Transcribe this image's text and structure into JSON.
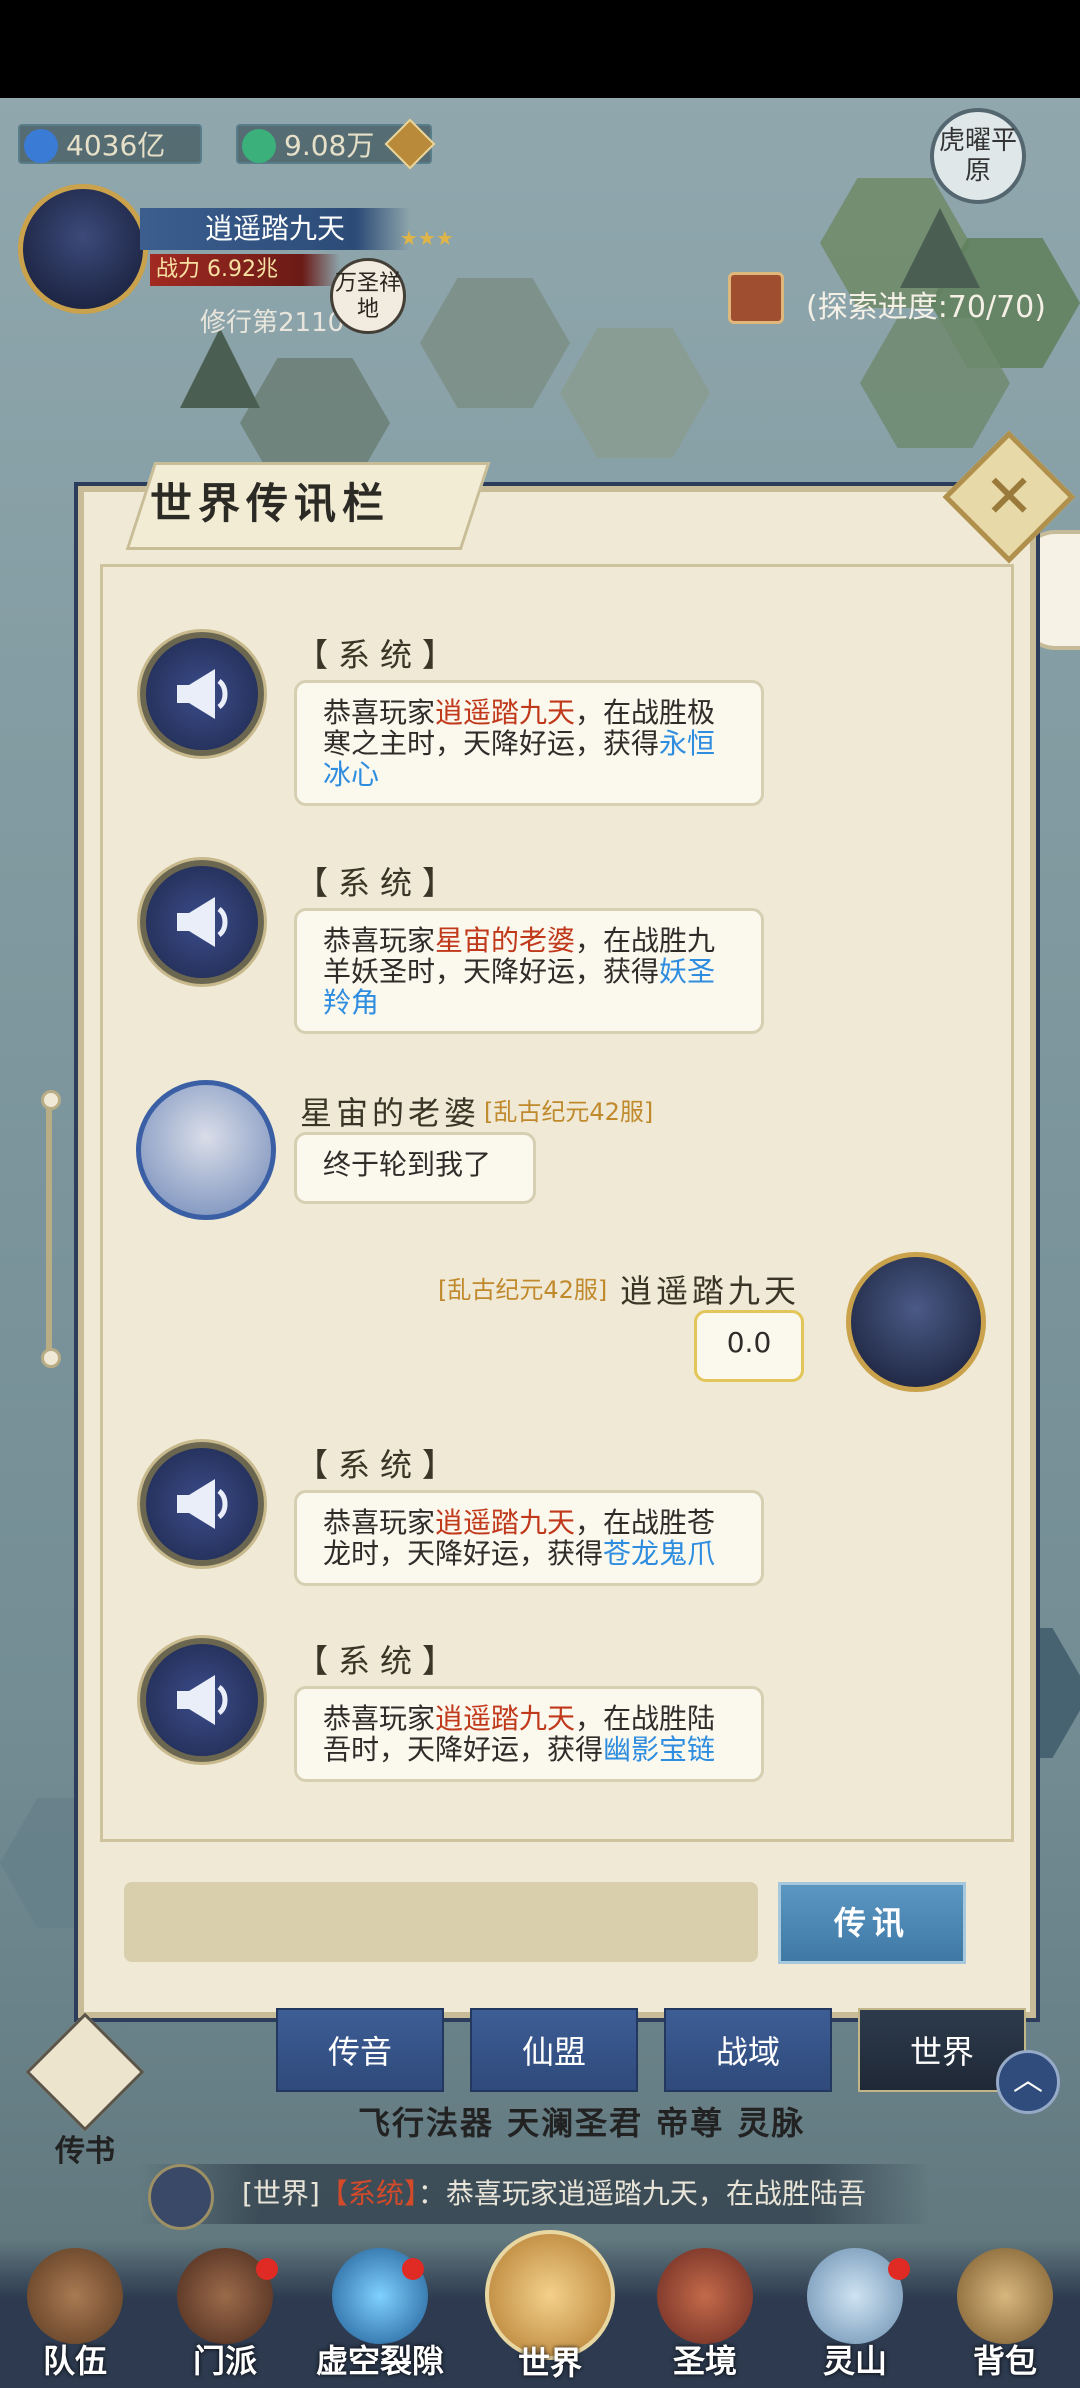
{
  "resources": {
    "spirit_stones": "4036亿",
    "jade": "9.08万"
  },
  "player": {
    "name": "逍遥踏九天",
    "power": "战力 6.92兆",
    "cultivation": "修行第21104年"
  },
  "map": {
    "explore_progress": "(探索进度:70/70)",
    "huyao_badge": "虎曜平原",
    "wansheng_badge": "万圣祥地"
  },
  "dialog": {
    "title": "世界传讯栏",
    "messages": [
      {
        "type": "system",
        "sender": "【系统】",
        "pre": "恭喜玩家",
        "player": "逍遥踏九天",
        "mid": "，在战胜极寒之主时，天降好运，获得",
        "item": "永恒冰心"
      },
      {
        "type": "system",
        "sender": "【系统】",
        "pre": "恭喜玩家",
        "player": "星宙的老婆",
        "mid": "，在战胜九羊妖圣时，天降好运，获得",
        "item": "妖圣羚角"
      },
      {
        "type": "chat",
        "sender": "星宙的老婆",
        "server": "[乱古纪元42服]",
        "text": "终于轮到我了"
      },
      {
        "type": "chat_self",
        "sender": "逍遥踏九天",
        "server": "[乱古纪元42服]",
        "text": "0.0"
      },
      {
        "type": "system",
        "sender": "【系统】",
        "pre": "恭喜玩家",
        "player": "逍遥踏九天",
        "mid": "，在战胜苍龙时，天降好运，获得",
        "item": "苍龙鬼爪"
      },
      {
        "type": "system",
        "sender": "【系统】",
        "pre": "恭喜玩家",
        "player": "逍遥踏九天",
        "mid": "，在战胜陆吾时，天降好运，获得",
        "item": "幽影宝链"
      }
    ],
    "input_placeholder": "",
    "send_label": "传讯"
  },
  "tabs": [
    "传音",
    "仙盟",
    "战域",
    "世界"
  ],
  "active_tab": "世界",
  "side": {
    "chuanshu": "传书"
  },
  "function_row": "飞行法器 天澜圣君  帝尊  灵脉",
  "ticker": {
    "channel": "[世界]",
    "sender": "【系统】",
    "text": "：恭喜玩家逍遥踏九天，在战胜陆吾"
  },
  "nav": [
    "队伍",
    "门派",
    "虚空裂隙",
    "世界",
    "圣境",
    "灵山",
    "背包"
  ],
  "colors": {
    "player_name": "#c0391b",
    "item_name": "#2f8de0",
    "server_tag": "#c08a2c",
    "dialog_bg": "#efe9d6",
    "tab_blue": "#3d5d95"
  }
}
